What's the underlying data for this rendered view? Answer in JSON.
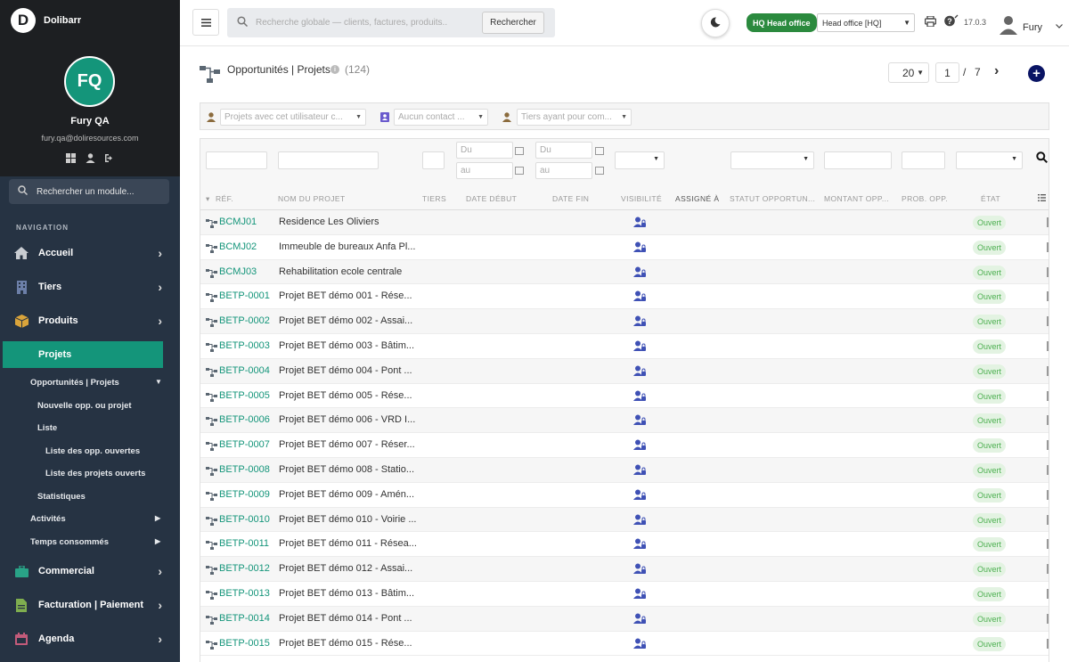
{
  "app": {
    "name": "Dolibarr",
    "logo_letter": "D"
  },
  "user": {
    "initials": "FQ",
    "name": "Fury QA",
    "email": "fury.qa@doliresources.com",
    "short": "Fury"
  },
  "module_search": {
    "label": "Rechercher un module..."
  },
  "nav": {
    "heading": "NAVIGATION",
    "items": [
      {
        "label": "Accueil",
        "icon": "home-icon"
      },
      {
        "label": "Tiers",
        "icon": "building-icon"
      },
      {
        "label": "Produits",
        "icon": "box-icon"
      },
      {
        "label": "Projets",
        "icon": "project-icon",
        "active": true
      },
      {
        "label": "Commercial",
        "icon": "briefcase-icon"
      },
      {
        "label": "Facturation | Paiement",
        "icon": "invoice-icon"
      },
      {
        "label": "Agenda",
        "icon": "calendar-icon"
      }
    ],
    "sub": [
      "Opportunités | Projets",
      "Nouvelle opp. ou projet",
      "Liste",
      "Liste des opp. ouvertes",
      "Liste des projets ouverts",
      "Statistiques",
      "Activités",
      "Temps consommés"
    ]
  },
  "topbar": {
    "search_placeholder": "Recherche globale — clients, factures, produits...",
    "search_button": "Rechercher",
    "entity_badge": "HQ Head office",
    "entity_select": "Head office [HQ]",
    "version": "17.0.3"
  },
  "page": {
    "title": "Opportunités | Projets",
    "count": "(124)",
    "limit": "20",
    "page": "1",
    "page_sep": "/",
    "total_pages": "7"
  },
  "filters": {
    "user": "Projets avec cet utilisateur c...",
    "contact": "Aucun contact ...",
    "thirdparty": "Tiers ayant pour com..."
  },
  "date_placeholders": {
    "from": "Du",
    "to": "au"
  },
  "columns": [
    "RÉF.",
    "NOM DU PROJET",
    "TIERS",
    "DATE DÉBUT",
    "DATE FIN",
    "VISIBILITÉ",
    "ASSIGNÉ À",
    "STATUT OPPORTUN...",
    "MONTANT OPP...",
    "PROB. OPP.",
    "ÉTAT"
  ],
  "rows": [
    {
      "ref": "BCMJ01",
      "name": "Residence Les Oliviers",
      "status": "Ouvert"
    },
    {
      "ref": "BCMJ02",
      "name": "Immeuble de bureaux Anfa Pl...",
      "status": "Ouvert"
    },
    {
      "ref": "BCMJ03",
      "name": "Rehabilitation ecole centrale",
      "status": "Ouvert"
    },
    {
      "ref": "BETP-0001",
      "name": "Projet BET démo 001 - Rése...",
      "status": "Ouvert"
    },
    {
      "ref": "BETP-0002",
      "name": "Projet BET démo 002 - Assai...",
      "status": "Ouvert"
    },
    {
      "ref": "BETP-0003",
      "name": "Projet BET démo 003 - Bâtim...",
      "status": "Ouvert"
    },
    {
      "ref": "BETP-0004",
      "name": "Projet BET démo 004 - Pont ...",
      "status": "Ouvert"
    },
    {
      "ref": "BETP-0005",
      "name": "Projet BET démo 005 - Rése...",
      "status": "Ouvert"
    },
    {
      "ref": "BETP-0006",
      "name": "Projet BET démo 006 - VRD I...",
      "status": "Ouvert"
    },
    {
      "ref": "BETP-0007",
      "name": "Projet BET démo 007 - Réser...",
      "status": "Ouvert"
    },
    {
      "ref": "BETP-0008",
      "name": "Projet BET démo 008 - Statio...",
      "status": "Ouvert"
    },
    {
      "ref": "BETP-0009",
      "name": "Projet BET démo 009 - Amén...",
      "status": "Ouvert"
    },
    {
      "ref": "BETP-0010",
      "name": "Projet BET démo 010 - Voirie ...",
      "status": "Ouvert"
    },
    {
      "ref": "BETP-0011",
      "name": "Projet BET démo 011 - Résea...",
      "status": "Ouvert"
    },
    {
      "ref": "BETP-0012",
      "name": "Projet BET démo 012 - Assai...",
      "status": "Ouvert"
    },
    {
      "ref": "BETP-0013",
      "name": "Projet BET démo 013 - Bâtim...",
      "status": "Ouvert"
    },
    {
      "ref": "BETP-0014",
      "name": "Projet BET démo 014 - Pont ...",
      "status": "Ouvert"
    },
    {
      "ref": "BETP-0015",
      "name": "Projet BET démo 015 - Rése...",
      "status": "Ouvert"
    }
  ],
  "colors": {
    "accent": "#14957a",
    "sidebar": "#263343",
    "brand_dark": "#1d1f22",
    "status_bg": "#e3f3e2",
    "status_text": "#4caf50",
    "add_button": "#0a1464"
  }
}
